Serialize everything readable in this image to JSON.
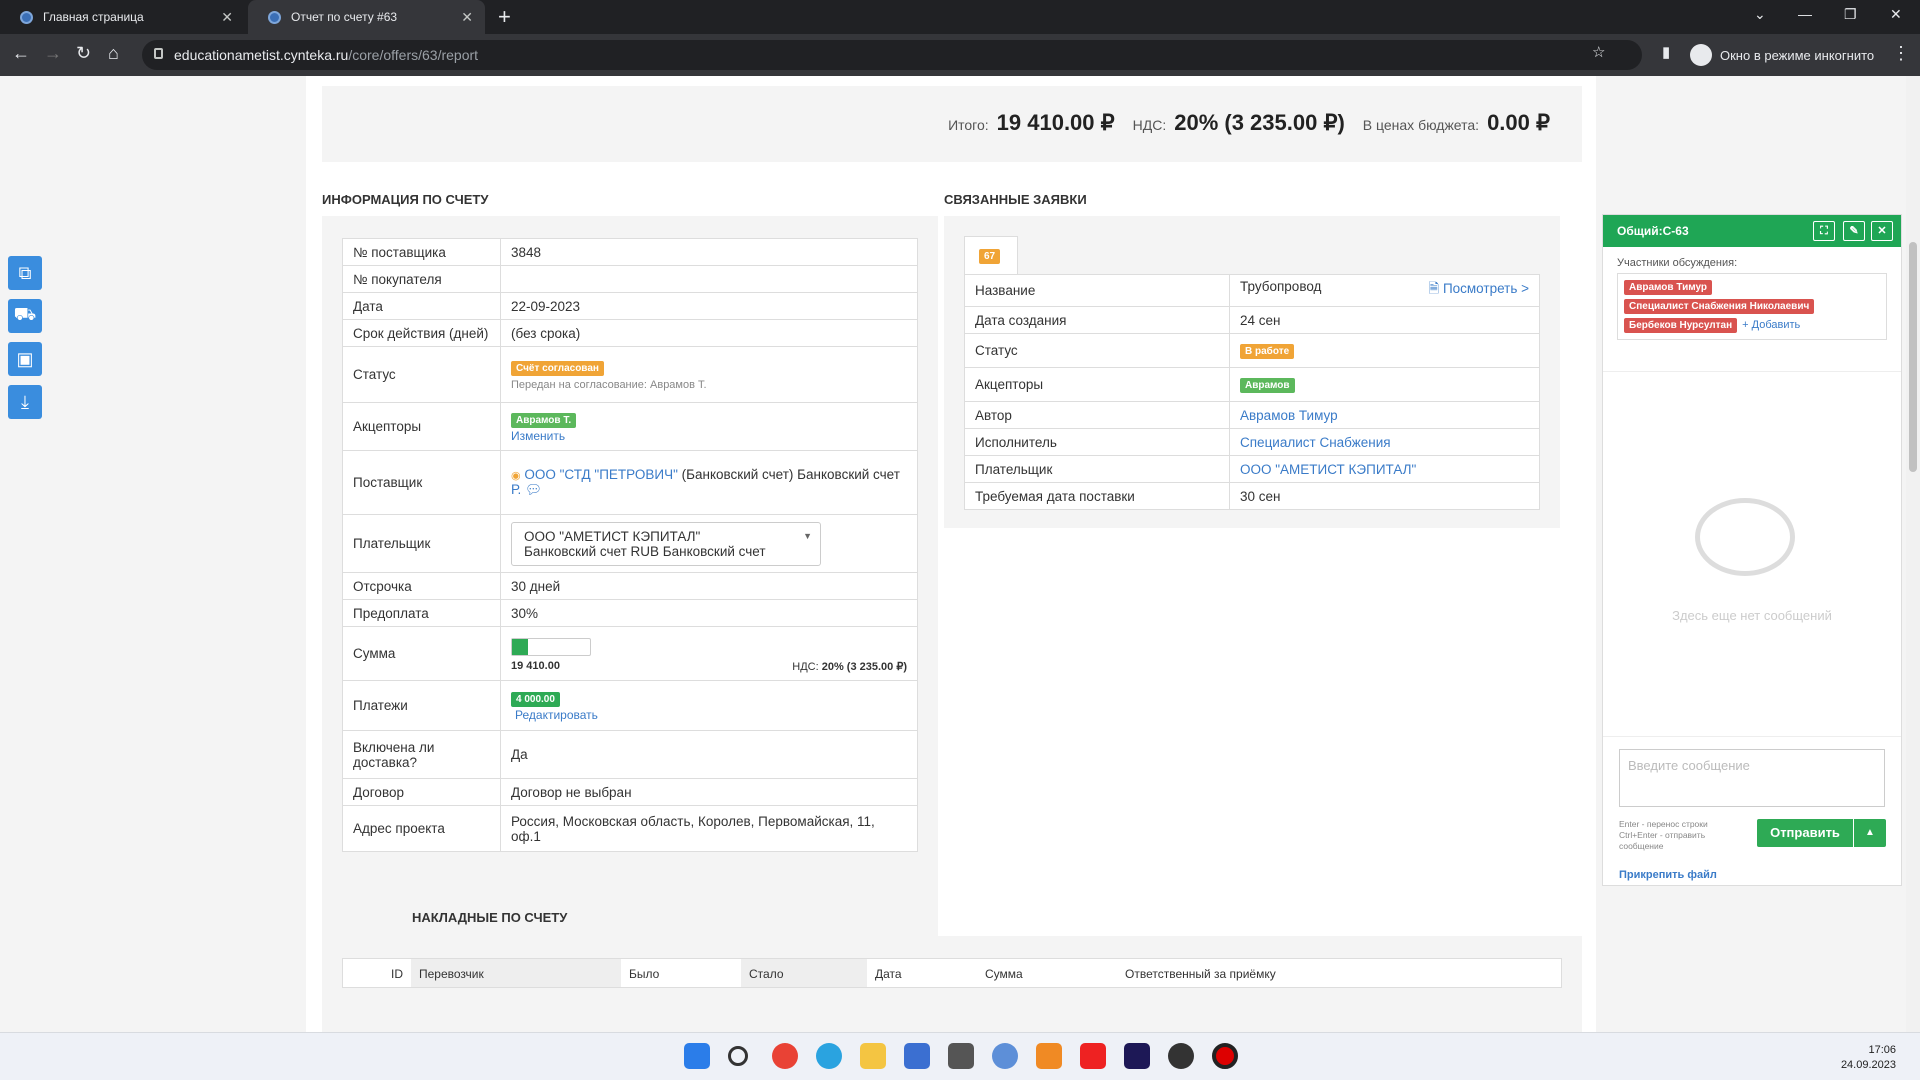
{
  "browser": {
    "tabs": [
      {
        "title": "Главная страница"
      },
      {
        "title": "Отчет по счету #63"
      }
    ],
    "url_host": "educationametist.cynteka.ru",
    "url_path": "/core/offers/63/report",
    "incognito_label": "Окно в режиме инкогнито"
  },
  "totals": {
    "total_label": "Итого:",
    "total_value": "19 410.00 ₽",
    "vat_label": "НДС:",
    "vat_value": "20% (3 235.00 ₽)",
    "budget_label": "В ценах бюджета:",
    "budget_value": "0.00 ₽"
  },
  "invoice_info": {
    "title": "ИНФОРМАЦИЯ ПО СЧЕТУ",
    "supplier_no_label": "№ поставщика",
    "supplier_no": "3848",
    "buyer_no_label": "№ покупателя",
    "buyer_no": "",
    "date_label": "Дата",
    "date": "22-09-2023",
    "validity_label": "Срок действия (дней)",
    "validity": "(без срока)",
    "status_label": "Статус",
    "status_badge": "Счёт согласован",
    "status_note": "Передан на согласование: Аврамов Т.",
    "acceptors_label": "Акцепторы",
    "acceptor_badge": "Аврамов Т.",
    "change_link": "Изменить",
    "supplier_label": "Поставщик",
    "supplier_link": "ООО \"СТД \"ПЕТРОВИЧ\"",
    "supplier_text": "(Банковский счет) Банковский счет",
    "supplier_short": "Р.",
    "payer_label": "Плательщик",
    "payer_select_line1": "ООО \"АМЕТИСТ КЭПИТАЛ\"",
    "payer_select_line2": "Банковский счет RUB Банковский счет",
    "deferral_label": "Отсрочка",
    "deferral": "30 дней",
    "prepay_label": "Предоплата",
    "prepay": "30%",
    "sum_label": "Сумма",
    "sum_value": "19 410.00",
    "sum_vat_label": "НДС:",
    "sum_vat_value": "20% (3 235.00 ₽)",
    "paid_fraction": 0.206,
    "payments_label": "Платежи",
    "payment_badge": "4 000.00",
    "edit_link": "Редактировать",
    "delivery_label": "Включена ли доставка?",
    "delivery": "Да",
    "contract_label": "Договор",
    "contract": "Договор не выбран",
    "address_label": "Адрес проекта",
    "address": "Россия, Московская область, Королев, Первомайская, 11, оф.1"
  },
  "related": {
    "title": "СВЯЗАННЫЕ ЗАЯВКИ",
    "tab_badge": "67",
    "name_label": "Название",
    "name": "Трубопровод",
    "view_link": "Посмотреть >",
    "created_label": "Дата создания",
    "created": "24 сен",
    "status_label": "Статус",
    "status_badge": "В работе",
    "acceptors_label": "Акцепторы",
    "acceptor_badge": "Аврамов",
    "author_label": "Автор",
    "author": "Аврамов Тимур",
    "executor_label": "Исполнитель",
    "executor": "Специалист Снабжения",
    "payer_label": "Плательщик",
    "payer": "ООО \"АМЕТИСТ КЭПИТАЛ\"",
    "delivery_date_label": "Требуемая дата поставки",
    "delivery_date": "30 сен"
  },
  "waybills": {
    "title": "НАКЛАДНЫЕ ПО СЧЕТУ",
    "columns": [
      "ID",
      "Перевозчик",
      "Было",
      "Стало",
      "Дата",
      "Сумма",
      "Ответственный за приёмку"
    ]
  },
  "chat": {
    "title": "Общий:С-63",
    "participants_label": "Участники обсуждения:",
    "participants": [
      "Аврамов Тимур",
      "Специалист Снабжения Николаевич",
      "Бербеков Нурсултан"
    ],
    "add_link": "Добавить",
    "empty_text": "Здесь еще нет сообщений",
    "input_placeholder": "Введите сообщение",
    "hint": "Enter - перенос строки Ctrl+Enter - отправить сообщение",
    "send_label": "Отправить",
    "attach_label": "Прикрепить файл"
  },
  "taskbar": {
    "time": "17:06",
    "date": "24.09.2023"
  },
  "colors": {
    "chat_header": "#1fa655",
    "badge_orange": "#f0a436",
    "badge_red": "#d9534f",
    "link": "#3a7bc8"
  }
}
